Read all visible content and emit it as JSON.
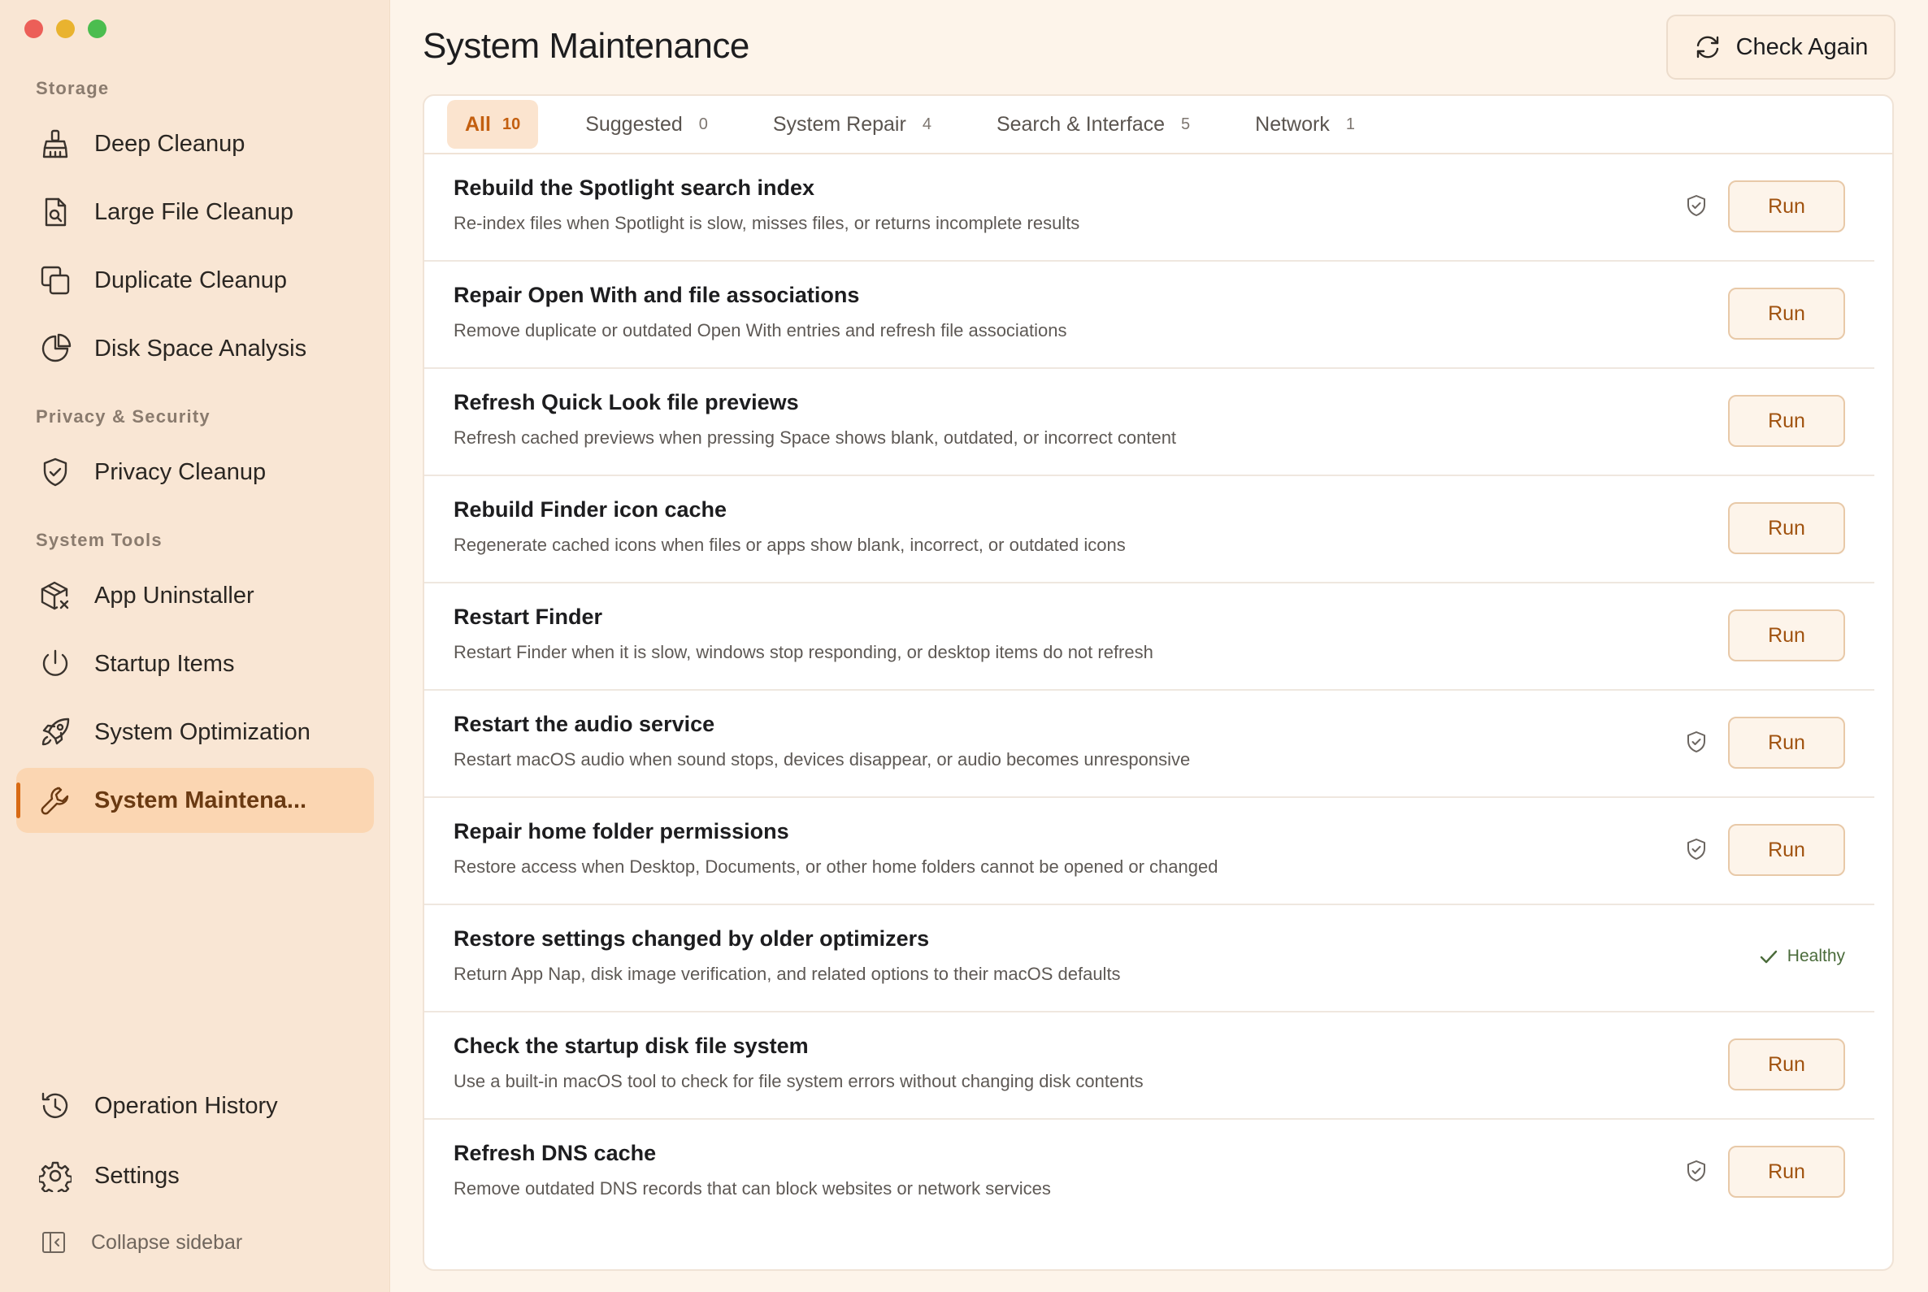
{
  "sidebar": {
    "sections": {
      "storage": "Storage",
      "privacy": "Privacy & Security",
      "tools": "System Tools"
    },
    "items": {
      "deep_cleanup": "Deep Cleanup",
      "large_file_cleanup": "Large File Cleanup",
      "duplicate_cleanup": "Duplicate Cleanup",
      "disk_space_analysis": "Disk Space Analysis",
      "privacy_cleanup": "Privacy Cleanup",
      "app_uninstaller": "App Uninstaller",
      "startup_items": "Startup Items",
      "system_optimization": "System Optimization",
      "system_maintenance": "System Maintena...",
      "operation_history": "Operation History",
      "settings": "Settings"
    },
    "collapse_label": "Collapse sidebar"
  },
  "header": {
    "title": "System Maintenance",
    "check_again_label": "Check Again"
  },
  "tabs": [
    {
      "label": "All",
      "count": "10",
      "active": true
    },
    {
      "label": "Suggested",
      "count": "0"
    },
    {
      "label": "System Repair",
      "count": "4"
    },
    {
      "label": "Search & Interface",
      "count": "5"
    },
    {
      "label": "Network",
      "count": "1"
    }
  ],
  "run_label": "Run",
  "healthy_label": "Healthy",
  "tasks": [
    {
      "title": "Rebuild the Spotlight search index",
      "desc": "Re-index files when Spotlight is slow, misses files, or returns incomplete results"
    },
    {
      "title": "Repair Open With and file associations",
      "desc": "Remove duplicate or outdated Open With entries and refresh file associations"
    },
    {
      "title": "Refresh Quick Look file previews",
      "desc": "Refresh cached previews when pressing Space shows blank, outdated, or incorrect content"
    },
    {
      "title": "Rebuild Finder icon cache",
      "desc": "Regenerate cached icons when files or apps show blank, incorrect, or outdated icons"
    },
    {
      "title": "Restart Finder",
      "desc": "Restart Finder when it is slow, windows stop responding, or desktop items do not refresh"
    },
    {
      "title": "Restart the audio service",
      "desc": "Restart macOS audio when sound stops, devices disappear, or audio becomes unresponsive"
    },
    {
      "title": "Repair home folder permissions",
      "desc": "Restore access when Desktop, Documents, or other home folders cannot be opened or changed"
    },
    {
      "title": "Restore settings changed by older optimizers",
      "desc": "Return App Nap, disk image verification, and related options to their macOS defaults"
    },
    {
      "title": "Check the startup disk file system",
      "desc": "Use a built-in macOS tool to check for file system errors without changing disk contents"
    },
    {
      "title": "Refresh DNS cache",
      "desc": "Remove outdated DNS records that can block websites or network services"
    }
  ]
}
